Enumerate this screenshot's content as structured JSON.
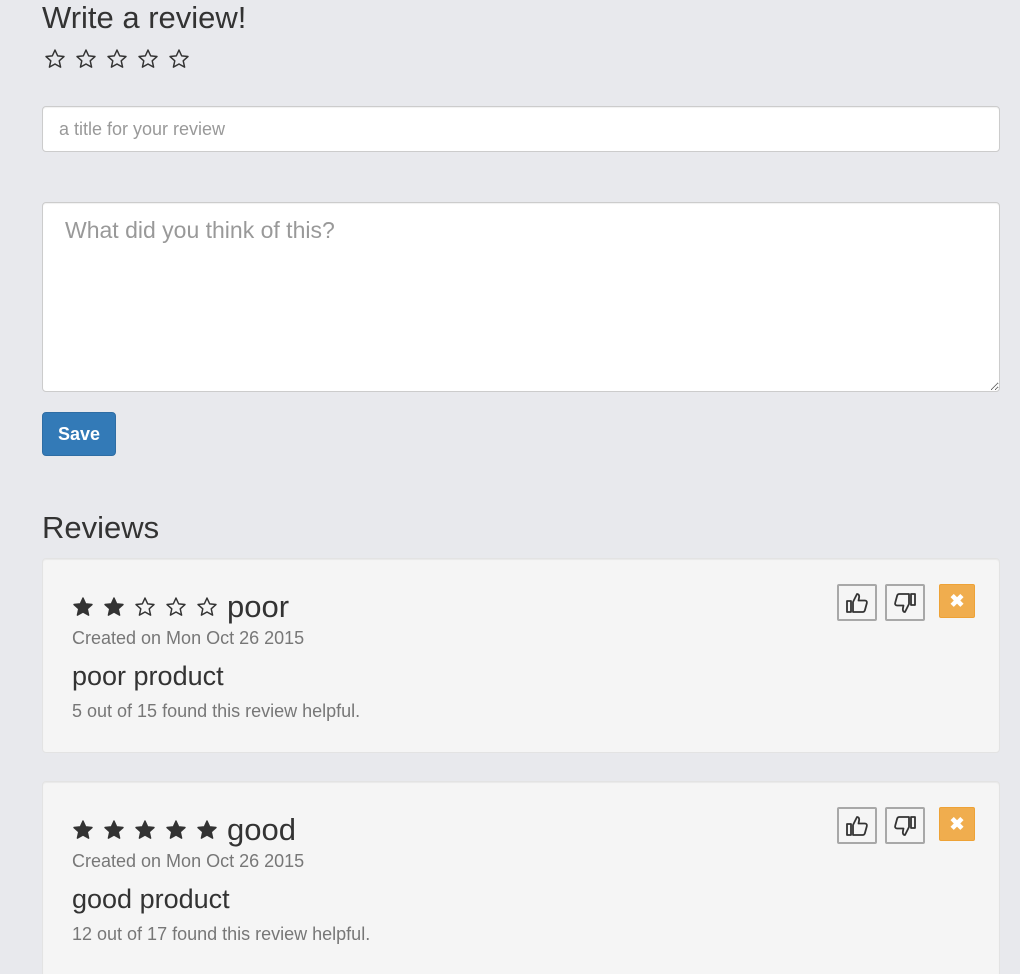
{
  "form": {
    "heading": "Write a review!",
    "rating": 0,
    "max_rating": 5,
    "title_placeholder": "a title for your review",
    "title_value": "",
    "body_placeholder": "What did you think of this?",
    "body_value": "",
    "save_label": "Save"
  },
  "reviews_heading": "Reviews",
  "reviews": [
    {
      "rating": 2,
      "rating_label": "poor",
      "created": "Created on Mon Oct 26 2015",
      "title": "poor product",
      "helpful": "5 out of 15 found this review helpful.",
      "upvote_icon": "thumbs-up-icon",
      "downvote_icon": "thumbs-down-icon",
      "delete_icon": "close-icon",
      "delete_glyph": "✖"
    },
    {
      "rating": 5,
      "rating_label": "good",
      "created": "Created on Mon Oct 26 2015",
      "title": "good product",
      "helpful": "12 out of 17 found this review helpful.",
      "upvote_icon": "thumbs-up-icon",
      "downvote_icon": "thumbs-down-icon",
      "delete_icon": "close-icon",
      "delete_glyph": "✖"
    }
  ],
  "colors": {
    "page_bg": "#e8e9ed",
    "primary": "#337ab7",
    "warning": "#f0ad4e",
    "muted_text": "#777777",
    "card_bg": "#f5f5f5"
  }
}
